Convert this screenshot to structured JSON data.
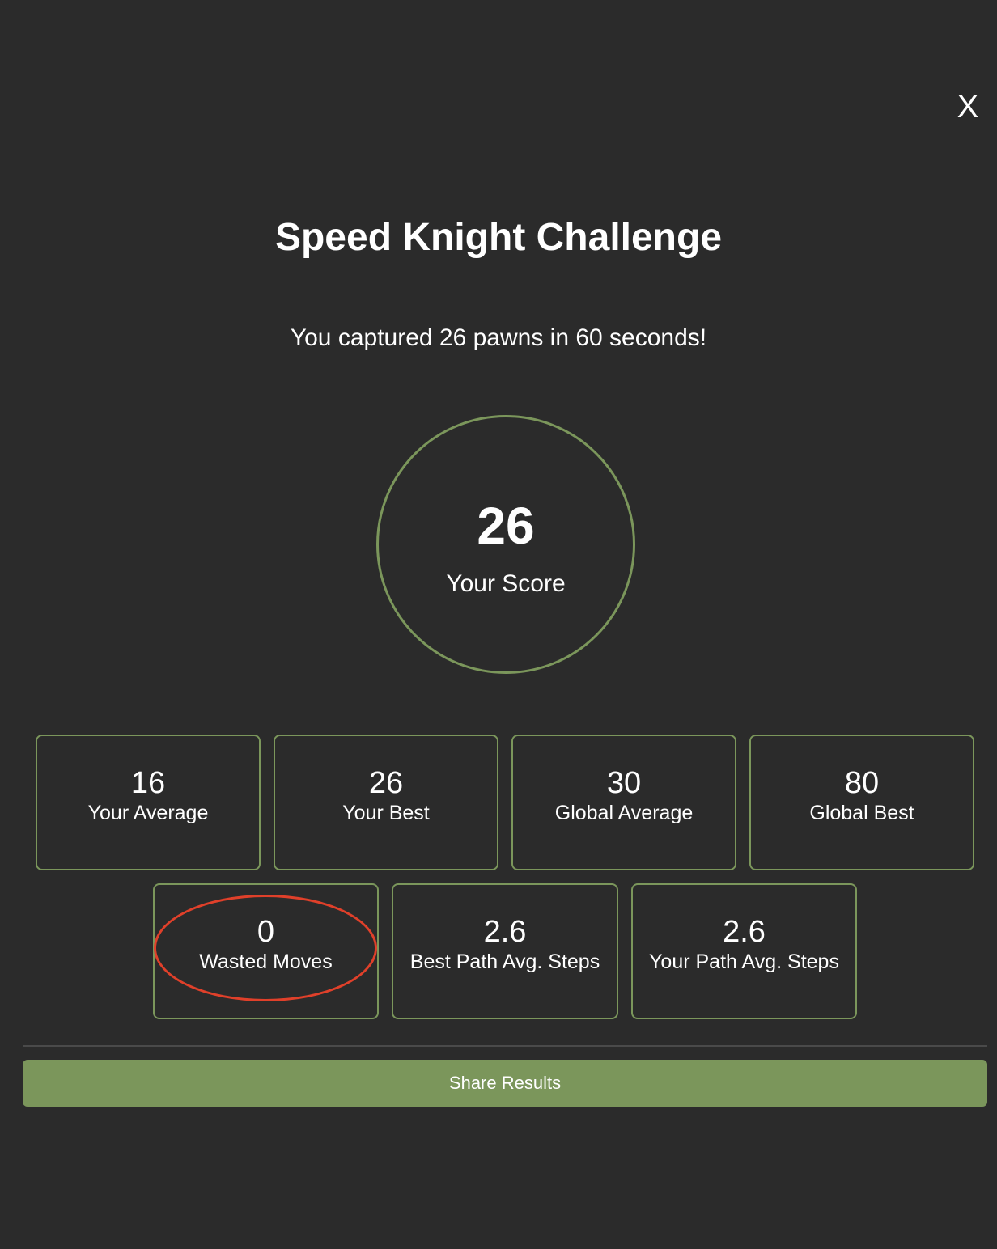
{
  "modal": {
    "close_label": "X",
    "title": "Speed Knight Challenge",
    "summary": "You captured 26 pawns in 60 seconds!",
    "score": {
      "value": "26",
      "label": "Your Score"
    },
    "stats": [
      {
        "value": "16",
        "label": "Your Average"
      },
      {
        "value": "26",
        "label": "Your Best"
      },
      {
        "value": "30",
        "label": "Global Average"
      },
      {
        "value": "80",
        "label": "Global Best"
      },
      {
        "value": "0",
        "label": "Wasted Moves"
      },
      {
        "value": "2.6",
        "label": "Best Path Avg. Steps"
      },
      {
        "value": "2.6",
        "label": "Your Path Avg. Steps"
      }
    ],
    "share_label": "Share Results"
  },
  "colors": {
    "background": "#2b2b2b",
    "accent": "#7b965b",
    "highlight": "#e0402a",
    "text": "#ffffff"
  }
}
